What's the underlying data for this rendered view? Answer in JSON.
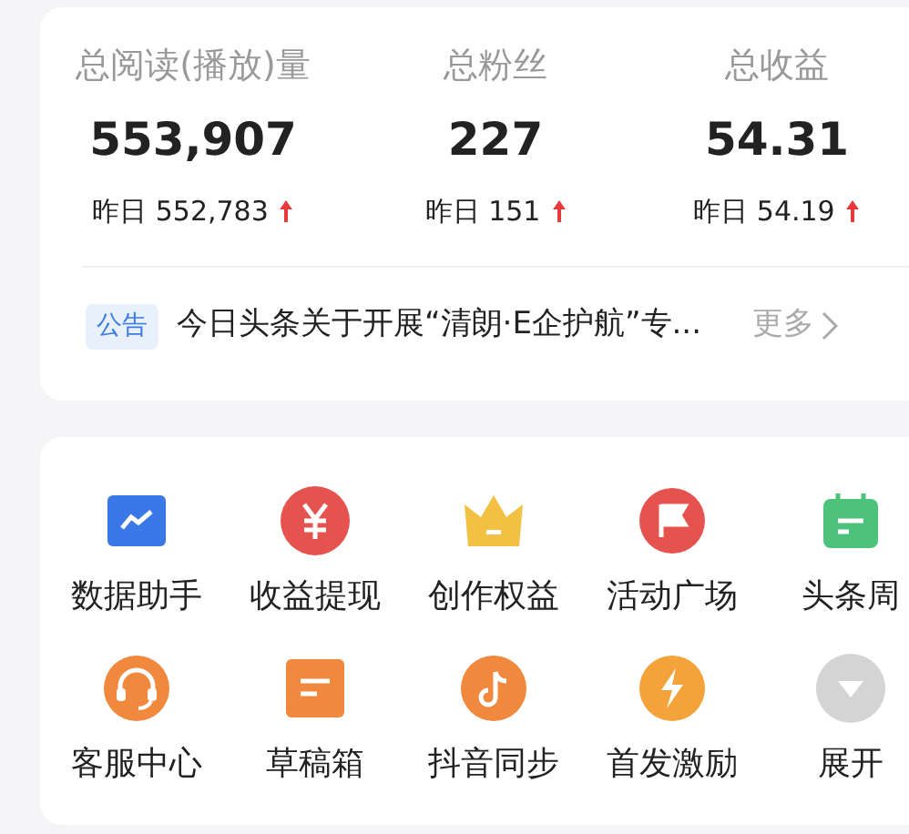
{
  "stats": [
    {
      "label": "总阅读(播放)量",
      "value": "553,907",
      "yesterday_label": "昨日",
      "yesterday": "552,783"
    },
    {
      "label": "总粉丝",
      "value": "227",
      "yesterday_label": "昨日",
      "yesterday": "151"
    },
    {
      "label": "总收益",
      "value": "54.31",
      "yesterday_label": "昨日",
      "yesterday": "54.19"
    }
  ],
  "notice": {
    "tag": "公告",
    "text": "今日头条关于开展“清朗·E企护航”专...",
    "more": "更多"
  },
  "tools": [
    {
      "kind": "chart",
      "label": "数据助手"
    },
    {
      "kind": "yen",
      "label": "收益提现"
    },
    {
      "kind": "crown",
      "label": "创作权益"
    },
    {
      "kind": "flag",
      "label": "活动广场"
    },
    {
      "kind": "calendar",
      "label": "头条周"
    },
    {
      "kind": "headset",
      "label": "客服中心"
    },
    {
      "kind": "draft",
      "label": "草稿箱"
    },
    {
      "kind": "note",
      "label": "抖音同步"
    },
    {
      "kind": "bolt",
      "label": "首发激励"
    },
    {
      "kind": "expand",
      "label": "展开"
    }
  ]
}
